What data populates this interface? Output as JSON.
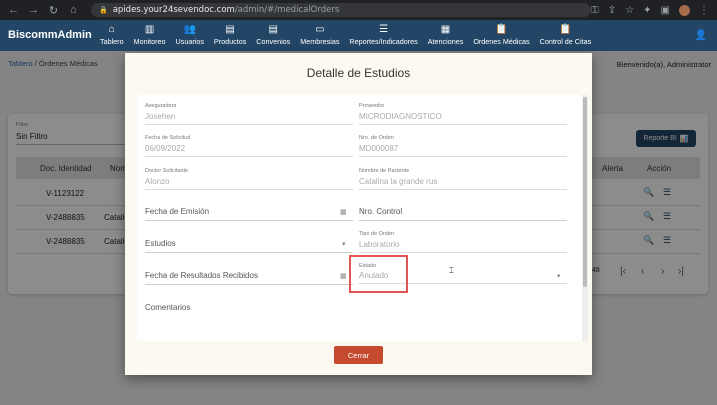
{
  "browser": {
    "url_host": "apides.your24sevendoc.com",
    "url_path": "/admin/#/medicalOrders"
  },
  "app": {
    "brand": "BiscommAdmin",
    "menu": [
      {
        "label": "Tablero",
        "icon": "home-icon"
      },
      {
        "label": "Monitoreo",
        "icon": "chart-icon"
      },
      {
        "label": "Usuarios",
        "icon": "users-icon"
      },
      {
        "label": "Productos",
        "icon": "store-icon"
      },
      {
        "label": "Convenios",
        "icon": "store-icon"
      },
      {
        "label": "Membresias",
        "icon": "card-icon"
      },
      {
        "label": "Reportes/Indicadores",
        "icon": "list-icon"
      },
      {
        "label": "Atenciones",
        "icon": "calendar-icon"
      },
      {
        "label": "Ordenes Médicas",
        "icon": "clipboard-icon"
      },
      {
        "label": "Control de Citas",
        "icon": "clipboard-icon"
      }
    ]
  },
  "page": {
    "breadcrumb_home": "Tablero",
    "breadcrumb_current": "/ Órdenes Médicas",
    "welcome": "Bienvenido(a), Administrator",
    "filter_label": "Filtro",
    "filter_value": "Sin Filtro",
    "report_button": "Reporte BI",
    "columns": [
      "Doc. Identidad",
      "Nom",
      "Alerta",
      "Acción"
    ],
    "rows": [
      {
        "doc": "V-1123122",
        "name": ""
      },
      {
        "doc": "V-2488835",
        "name": "Catali"
      },
      {
        "doc": "V-2488835",
        "name": "Catali"
      }
    ],
    "rows_per_page_fragment": "48"
  },
  "modal": {
    "title": "Detalle de Estudios",
    "fields": {
      "aseguradora_label": "Aseguradora",
      "aseguradora_value": "Josehen",
      "proveedor_label": "Proveedor",
      "proveedor_value": "MICRODIAGNOSTICO",
      "fecha_solicitud_label": "Fecha de Solicitud",
      "fecha_solicitud_value": "06/09/2022",
      "nro_orden_label": "Nro. de Orden",
      "nro_orden_value": "MD000087",
      "doctor_label": "Doctor Solicitante",
      "doctor_value": "Alonzo",
      "paciente_label": "Nombre de Paciente",
      "paciente_value": "Catalina la grande rus",
      "fecha_emision_placeholder": "Fecha de Emisión",
      "nro_control_placeholder": "Nro. Control",
      "estudios_placeholder": "Estudios",
      "tipo_orden_label": "Tipo de Orden",
      "tipo_orden_value": "Laboratorio",
      "fecha_resultados_placeholder": "Fecha de Resultados Recibidos",
      "estado_label": "Estado",
      "estado_value": "Anulado",
      "comentarios_placeholder": "Comentarios"
    },
    "close_button": "Cerrar",
    "highlight_color": "#e25555"
  },
  "colors": {
    "navbar": "#234666",
    "close_button": "#c64a30"
  }
}
